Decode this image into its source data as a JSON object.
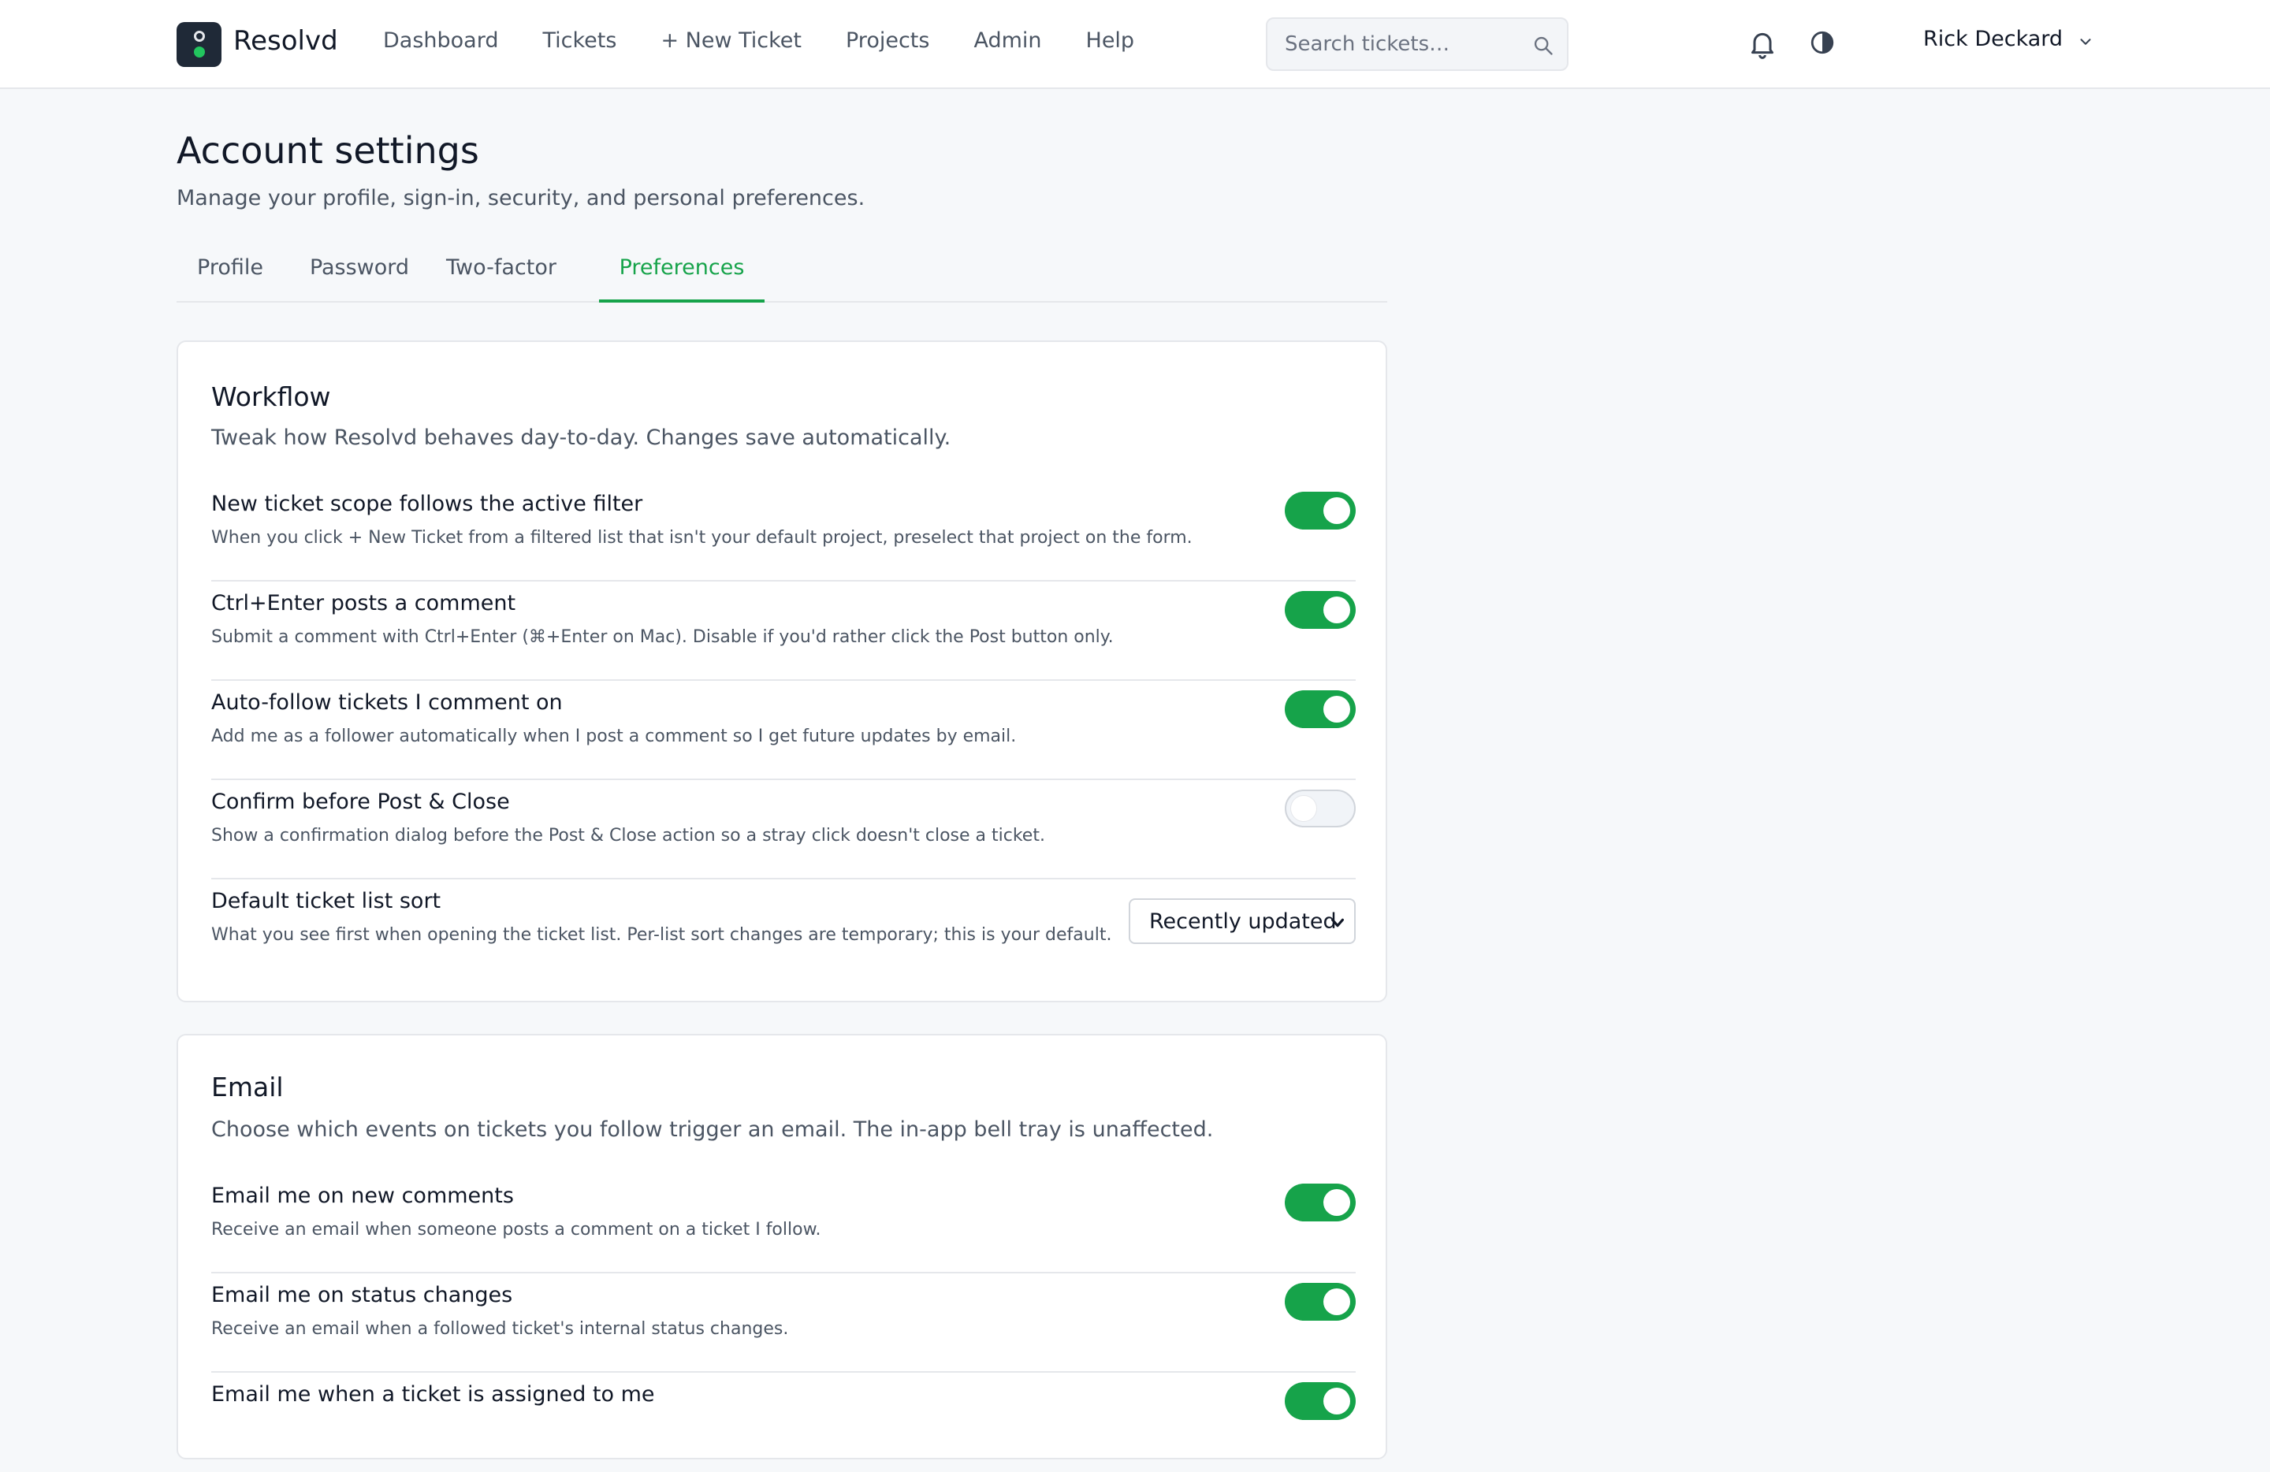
{
  "app": {
    "name": "Resolvd"
  },
  "nav": {
    "items": [
      "Dashboard",
      "Tickets",
      "+ New Ticket",
      "Projects",
      "Admin",
      "Help"
    ]
  },
  "search": {
    "placeholder": "Search tickets…"
  },
  "user": {
    "name": "Rick Deckard"
  },
  "page": {
    "title": "Account settings",
    "subtitle": "Manage your profile, sign-in, security, and personal preferences."
  },
  "tabs": [
    {
      "label": "Profile",
      "active": false
    },
    {
      "label": "Password",
      "active": false
    },
    {
      "label": "Two-factor",
      "active": false
    },
    {
      "label": "Preferences",
      "active": true
    }
  ],
  "workflow": {
    "title": "Workflow",
    "description": "Tweak how Resolvd behaves day-to-day. Changes save automatically.",
    "rows": [
      {
        "label": "New ticket scope follows the active filter",
        "help": "When you click + New Ticket from a filtered list that isn't your default project, preselect that project on the form.",
        "enabled": true
      },
      {
        "label": "Ctrl+Enter posts a comment",
        "help": "Submit a comment with Ctrl+Enter (⌘+Enter on Mac). Disable if you'd rather click the Post button only.",
        "enabled": true
      },
      {
        "label": "Auto-follow tickets I comment on",
        "help": "Add me as a follower automatically when I post a comment so I get future updates by email.",
        "enabled": true
      },
      {
        "label": "Confirm before Post & Close",
        "help": "Show a confirmation dialog before the Post & Close action so a stray click doesn't close a ticket.",
        "enabled": false
      }
    ],
    "sort": {
      "label": "Default ticket list sort",
      "help": "What you see first when opening the ticket list. Per-list sort changes are temporary; this is your default.",
      "value": "Recently updated"
    }
  },
  "email": {
    "title": "Email",
    "description": "Choose which events on tickets you follow trigger an email. The in-app bell tray is unaffected.",
    "rows": [
      {
        "label": "Email me on new comments",
        "help": "Receive an email when someone posts a comment on a ticket I follow.",
        "enabled": true
      },
      {
        "label": "Email me on status changes",
        "help": "Receive an email when a followed ticket's internal status changes.",
        "enabled": true
      },
      {
        "label": "Email me when a ticket is assigned to me",
        "help": "",
        "enabled": true
      }
    ]
  },
  "colors": {
    "accent": "#16a34a",
    "text": "#111827",
    "muted": "#4b5563",
    "border": "#e5e7eb"
  }
}
